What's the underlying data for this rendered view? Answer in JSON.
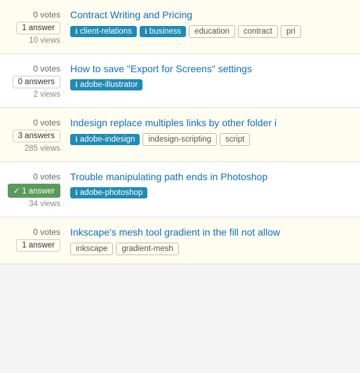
{
  "questions": [
    {
      "id": 1,
      "votes": "0 votes",
      "answers_label": "1 answer",
      "answers_accepted": false,
      "views": "10 views",
      "title": "Contract Writing and Pricing",
      "tags": [
        {
          "label": "client-relations",
          "style": "primary"
        },
        {
          "label": "business",
          "style": "primary"
        },
        {
          "label": "education",
          "style": "secondary"
        },
        {
          "label": "contract",
          "style": "secondary"
        },
        {
          "label": "pri",
          "style": "secondary"
        }
      ]
    },
    {
      "id": 2,
      "votes": "0 votes",
      "answers_label": "0 answers",
      "answers_accepted": false,
      "views": "2 views",
      "title": "How to save \"Export for Screens\" settings",
      "tags": [
        {
          "label": "adobe-illustrator",
          "style": "primary"
        }
      ]
    },
    {
      "id": 3,
      "votes": "0 votes",
      "answers_label": "3 answers",
      "answers_accepted": false,
      "views": "285 views",
      "title": "Indesign replace multiples links by other folder i",
      "tags": [
        {
          "label": "adobe-indesign",
          "style": "primary"
        },
        {
          "label": "indesign-scripting",
          "style": "secondary"
        },
        {
          "label": "script",
          "style": "secondary"
        }
      ]
    },
    {
      "id": 4,
      "votes": "0 votes",
      "answers_label": "1 answer",
      "answers_accepted": true,
      "views": "34 views",
      "title": "Trouble manipulating path ends in Photoshop",
      "tags": [
        {
          "label": "adobe-photoshop",
          "style": "primary"
        }
      ]
    },
    {
      "id": 5,
      "votes": "0 votes",
      "answers_label": "1 answer",
      "answers_accepted": false,
      "views": "",
      "title": "Inkscape's mesh tool gradient in the fill not allow",
      "tags": [
        {
          "label": "inkscape",
          "style": "secondary"
        },
        {
          "label": "gradient-mesh",
          "style": "secondary"
        }
      ]
    }
  ],
  "icons": {
    "tag_icon": "ℹ",
    "check": "✓"
  }
}
